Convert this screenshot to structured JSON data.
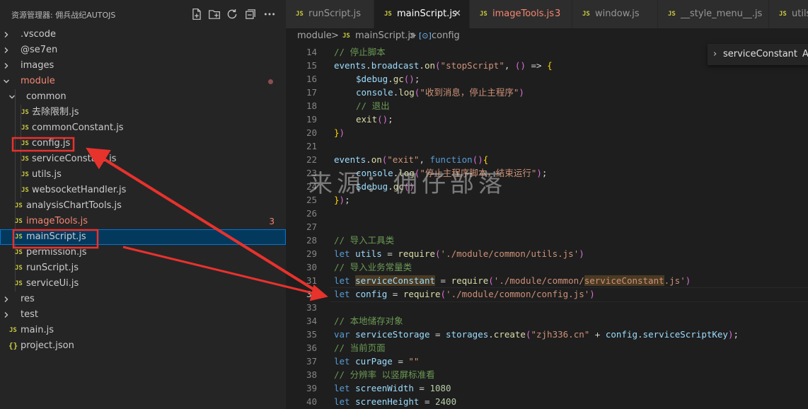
{
  "explorer": {
    "title": "资源管理器: 佣兵战纪AUTOJS",
    "tree": [
      {
        "label": ".vscode",
        "type": "folder"
      },
      {
        "label": "@se7en",
        "type": "folder"
      },
      {
        "label": "images",
        "type": "folder"
      },
      {
        "label": "module",
        "type": "folder-open"
      },
      {
        "label": "common",
        "type": "folder-open"
      },
      {
        "label": "去除限制.js",
        "type": "js"
      },
      {
        "label": "commonConstant.js",
        "type": "js"
      },
      {
        "label": "config.js",
        "type": "js"
      },
      {
        "label": "serviceConstant.js",
        "type": "js"
      },
      {
        "label": "utils.js",
        "type": "js"
      },
      {
        "label": "websocketHandler.js",
        "type": "js"
      },
      {
        "label": "analysisChartTools.js",
        "type": "js"
      },
      {
        "label": "imageTools.js",
        "type": "js",
        "badge": "3"
      },
      {
        "label": "mainScript.js",
        "type": "js"
      },
      {
        "label": "permission.js",
        "type": "js"
      },
      {
        "label": "runScript.js",
        "type": "js"
      },
      {
        "label": "serviceUi.js",
        "type": "js"
      },
      {
        "label": "res",
        "type": "folder"
      },
      {
        "label": "test",
        "type": "folder"
      },
      {
        "label": "main.js",
        "type": "js"
      },
      {
        "label": "project.json",
        "type": "json"
      }
    ],
    "icon_text": {
      "js": "JS",
      "json": "{}"
    }
  },
  "tabs": [
    {
      "label": "runScript.js"
    },
    {
      "label": "mainScript.js",
      "close": "✕"
    },
    {
      "label": "imageTools.js",
      "count": "3"
    },
    {
      "label": "window.js"
    },
    {
      "label": "__style_menu__.js"
    },
    {
      "label": "utils"
    }
  ],
  "breadcrumb": {
    "part1": "module",
    "sep": ">",
    "part2": "mainScript.js",
    "part3": "config"
  },
  "sticky": {
    "label": "serviceConstant",
    "extra": "A"
  },
  "code": {
    "lines": [
      {
        "n": "14",
        "t": [
          "// 停止脚本"
        ]
      },
      {
        "n": "15",
        "t": [
          "events",
          ".",
          "broadcast",
          ".",
          "on",
          "(",
          "\"stopScript\"",
          ", ",
          "()",
          " => ",
          "{"
        ]
      },
      {
        "n": "16",
        "t": [
          "$debug",
          ".",
          "gc",
          "()",
          ";"
        ]
      },
      {
        "n": "17",
        "t": [
          "console",
          ".",
          "log",
          "(",
          "\"收到消息，停止主程序\"",
          ")"
        ]
      },
      {
        "n": "18",
        "t": [
          "// 退出"
        ]
      },
      {
        "n": "19",
        "t": [
          "exit",
          "()",
          ";"
        ]
      },
      {
        "n": "20",
        "t": [
          "}",
          ")"
        ]
      },
      {
        "n": "21",
        "t": []
      },
      {
        "n": "22",
        "t": [
          "events",
          ".",
          "on",
          "(",
          "\"exit\"",
          ", ",
          "function",
          "()",
          "{"
        ]
      },
      {
        "n": "23",
        "t": [
          "console",
          ".",
          "log",
          "(",
          "\"停止主程序脚本，结束运行\"",
          ")",
          ";"
        ]
      },
      {
        "n": "24",
        "t": [
          "$debug",
          ".",
          "gc",
          "()"
        ]
      },
      {
        "n": "25",
        "t": [
          "}",
          ")",
          ";"
        ]
      },
      {
        "n": "26",
        "t": []
      },
      {
        "n": "27",
        "t": []
      },
      {
        "n": "28",
        "t": [
          "// 导入工具类"
        ]
      },
      {
        "n": "29",
        "t": [
          "let",
          " ",
          "utils",
          " = ",
          "require",
          "(",
          "'./module/common/utils.js'",
          ")"
        ]
      },
      {
        "n": "30",
        "t": [
          "// 导入业务常量类"
        ]
      },
      {
        "n": "31",
        "t": [
          "let",
          " ",
          "serviceConstant",
          " = ",
          "require",
          "(",
          "'./module/common/",
          "serviceConstant",
          ".js'",
          ")"
        ]
      },
      {
        "n": "32",
        "t": [
          "let",
          " ",
          "config",
          " = ",
          "require",
          "(",
          "'./module/common/config.js'",
          ")"
        ]
      },
      {
        "n": "33",
        "t": []
      },
      {
        "n": "34",
        "t": [
          "// 本地储存对象"
        ]
      },
      {
        "n": "35",
        "t": [
          "var",
          " ",
          "serviceStorage",
          " = ",
          "storages",
          ".",
          "create",
          "(",
          "\"zjh336.cn\"",
          " + ",
          "config",
          ".",
          "serviceScriptKey",
          ")",
          ";"
        ]
      },
      {
        "n": "36",
        "t": [
          "// 当前页面"
        ]
      },
      {
        "n": "37",
        "t": [
          "let",
          " ",
          "curPage",
          " = ",
          "\"\""
        ]
      },
      {
        "n": "38",
        "t": [
          "// 分辨率 以竖屏标准看"
        ]
      },
      {
        "n": "39",
        "t": [
          "let",
          " ",
          "screenWidth",
          " = ",
          "1080"
        ]
      },
      {
        "n": "40",
        "t": [
          "let",
          " ",
          "screenHeight",
          " = ",
          "2400"
        ]
      }
    ]
  },
  "watermark": "来源：佣仔部落",
  "colors": {
    "selection": "#04395e",
    "annotation_red": "#e8322c",
    "accent": "#0078d4"
  }
}
